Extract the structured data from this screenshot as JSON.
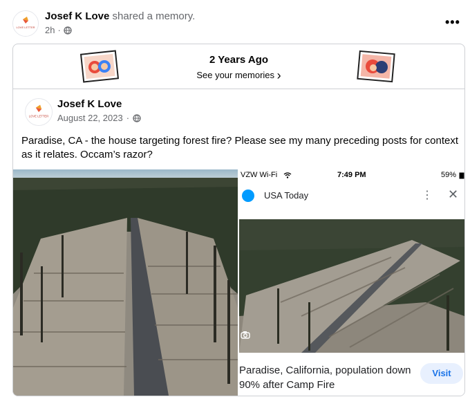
{
  "post": {
    "author": "Josef K Love",
    "action": "shared a memory.",
    "time": "2h",
    "more": "•••",
    "logo_text": "LOVE LETTER"
  },
  "memory": {
    "title": "2 Years Ago",
    "link": "See your memories",
    "chevron": "›"
  },
  "original": {
    "author": "Josef K Love",
    "date": "August 22, 2023",
    "text": "Paradise, CA - the house targeting forest fire? Please see my many preceding posts for context as it relates.  Occam’s razor?"
  },
  "screenshot": {
    "carrier": "VZW Wi-Fi",
    "time": "7:49 PM",
    "battery": "59%",
    "source": "USA Today",
    "dots": "⋮",
    "close": "✕",
    "headline": "Paradise, California, population down 90% after Camp Fire",
    "visit": "Visit"
  },
  "icons": [
    "globe-icon",
    "more-icon",
    "chevron-right-icon",
    "camera-icon",
    "wifi-icon",
    "close-icon"
  ]
}
